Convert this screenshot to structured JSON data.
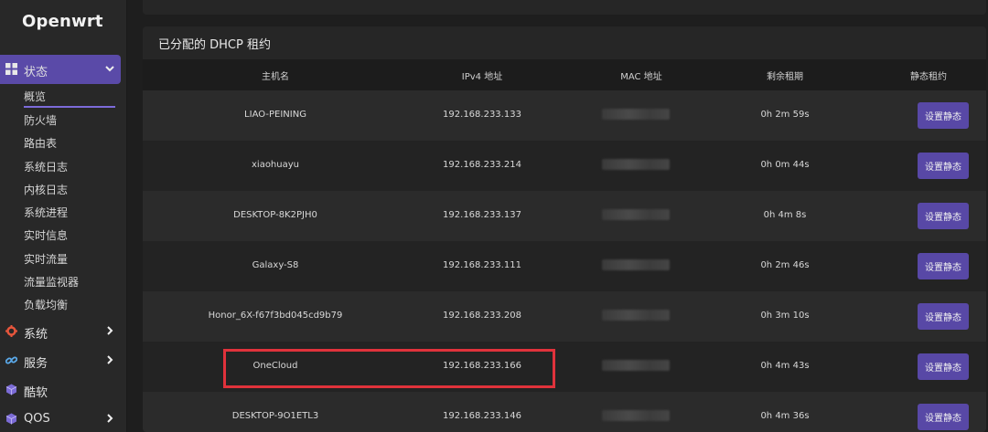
{
  "sidebar": {
    "logo": "Openwrt",
    "menu": [
      {
        "label": "状态",
        "icon": "dashboard-icon",
        "expanded": true
      },
      {
        "label": "系统",
        "icon": "gear-icon",
        "expanded": false
      },
      {
        "label": "服务",
        "icon": "link-icon",
        "expanded": false
      },
      {
        "label": "酷软",
        "icon": "cube-icon",
        "expanded": false
      },
      {
        "label": "QOS",
        "icon": "cube-icon",
        "expanded": false
      }
    ],
    "status_items": [
      "概览",
      "防火墙",
      "路由表",
      "系统日志",
      "内核日志",
      "系统进程",
      "实时信息",
      "实时流量",
      "流量监视器",
      "负载均衡"
    ]
  },
  "panel": {
    "title": "已分配的 DHCP 租约",
    "headers": [
      "主机名",
      "IPv4 地址",
      "MAC 地址",
      "剩余租期",
      "静态租约"
    ],
    "button_label": "设置静态",
    "rows": [
      {
        "hostname": "LIAO-PEINING",
        "ip": "192.168.233.133",
        "lease": "0h 2m 59s"
      },
      {
        "hostname": "xiaohuayu",
        "ip": "192.168.233.214",
        "lease": "0h 0m 44s"
      },
      {
        "hostname": "DESKTOP-8K2PJH0",
        "ip": "192.168.233.137",
        "lease": "0h 4m 8s"
      },
      {
        "hostname": "Galaxy-S8",
        "ip": "192.168.233.111",
        "lease": "0h 2m 46s"
      },
      {
        "hostname": "Honor_6X-f67f3bd045cd9b79",
        "ip": "192.168.233.208",
        "lease": "0h 3m 10s"
      },
      {
        "hostname": "OneCloud",
        "ip": "192.168.233.166",
        "lease": "0h 4m 43s"
      },
      {
        "hostname": "DESKTOP-9O1ETL3",
        "ip": "192.168.233.146",
        "lease": "0h 4m 36s"
      }
    ]
  },
  "colors": {
    "accent": "#5848a6",
    "highlight": "#e0323b"
  }
}
